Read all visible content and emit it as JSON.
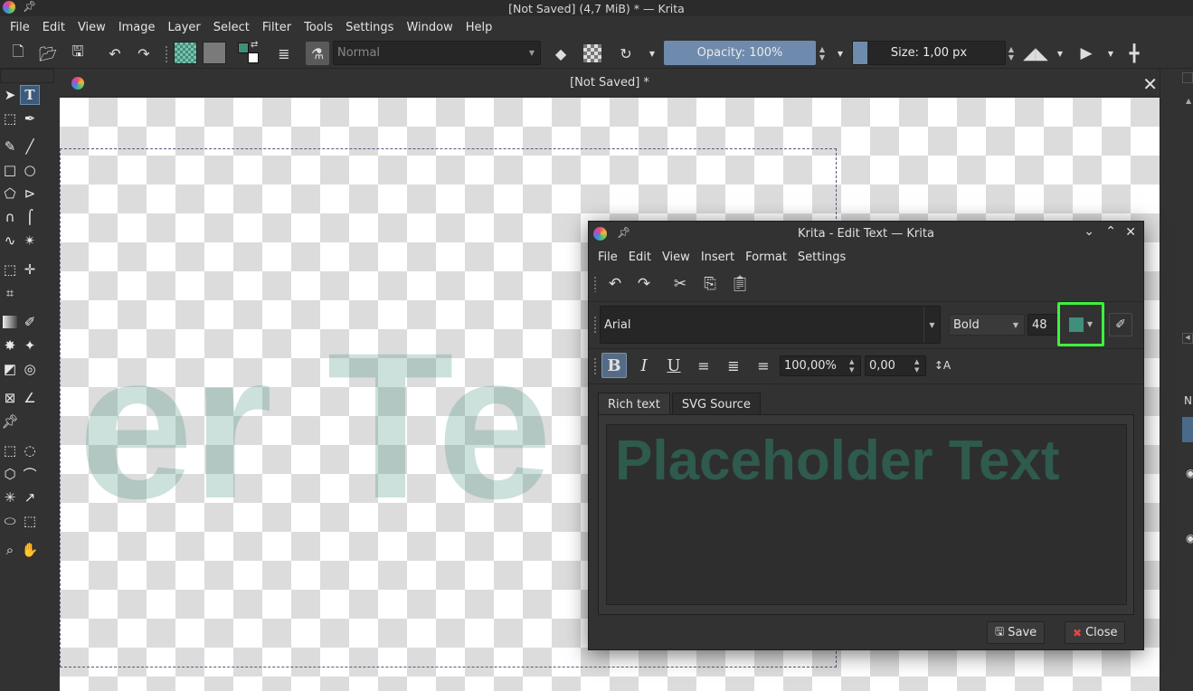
{
  "window": {
    "title": "[Not Saved] (4,7 MiB) * — Krita"
  },
  "menubar": [
    "File",
    "Edit",
    "View",
    "Image",
    "Layer",
    "Select",
    "Filter",
    "Tools",
    "Settings",
    "Window",
    "Help"
  ],
  "toolbar": {
    "blend_mode": "Normal",
    "opacity_label": "Opacity: 100%",
    "opacity_value": 1.0,
    "size_label": "Size: 1,00 px",
    "accent": "#6e8bad",
    "foreground_color": "#3f8f7b",
    "background_color": "#ffffff"
  },
  "document_tab": {
    "title": "[Not Saved]  *"
  },
  "canvas": {
    "text": "er Te",
    "text_color": "#3f8f7b"
  },
  "dialog": {
    "title": "Krita - Edit Text — Krita",
    "menu": [
      "File",
      "Edit",
      "View",
      "Insert",
      "Format",
      "Settings"
    ],
    "font_family": "Arial",
    "font_style": "Bold",
    "font_size": "48",
    "text_color": "#3f8f7b",
    "highlight_color": "#3df23d",
    "line_height": "100,00%",
    "letter_spacing": "0,00",
    "tabs": [
      "Rich text",
      "SVG Source"
    ],
    "placeholder_text": "Placeholder Text",
    "save_label": "Save",
    "close_label": "Close"
  },
  "right_dock": {
    "fragment_label": "N"
  }
}
